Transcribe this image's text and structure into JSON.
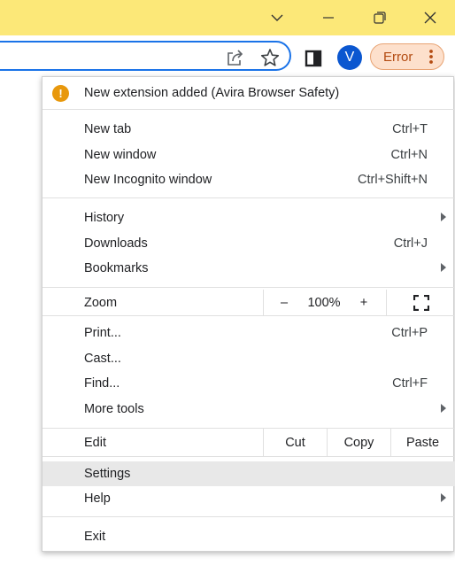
{
  "window": {
    "tab_search_icon": "chevron-down-icon",
    "minimize_icon": "minimize-icon",
    "restore_icon": "restore-icon",
    "close_icon": "close-icon"
  },
  "toolbar": {
    "avatar_initial": "V",
    "error_label": "Error",
    "colors": {
      "title_bar": "#fce878",
      "omnibox_border": "#1a73e8",
      "avatar": "#0b57d0",
      "error_chip": "#fde0cc"
    }
  },
  "menu": {
    "notification": {
      "text": "New extension added (Avira Browser Safety)",
      "icon": "!"
    },
    "new_tab": {
      "label": "New tab",
      "shortcut": "Ctrl+T"
    },
    "new_window": {
      "label": "New window",
      "shortcut": "Ctrl+N"
    },
    "new_incognito": {
      "label": "New Incognito window",
      "shortcut": "Ctrl+Shift+N"
    },
    "history": {
      "label": "History"
    },
    "downloads": {
      "label": "Downloads",
      "shortcut": "Ctrl+J"
    },
    "bookmarks": {
      "label": "Bookmarks"
    },
    "zoom": {
      "label": "Zoom",
      "minus": "–",
      "value": "100%",
      "plus": "+"
    },
    "print": {
      "label": "Print...",
      "shortcut": "Ctrl+P"
    },
    "cast": {
      "label": "Cast..."
    },
    "find": {
      "label": "Find...",
      "shortcut": "Ctrl+F"
    },
    "more_tools": {
      "label": "More tools"
    },
    "edit": {
      "label": "Edit",
      "cut": "Cut",
      "copy": "Copy",
      "paste": "Paste"
    },
    "settings": {
      "label": "Settings"
    },
    "help": {
      "label": "Help"
    },
    "exit": {
      "label": "Exit"
    }
  }
}
